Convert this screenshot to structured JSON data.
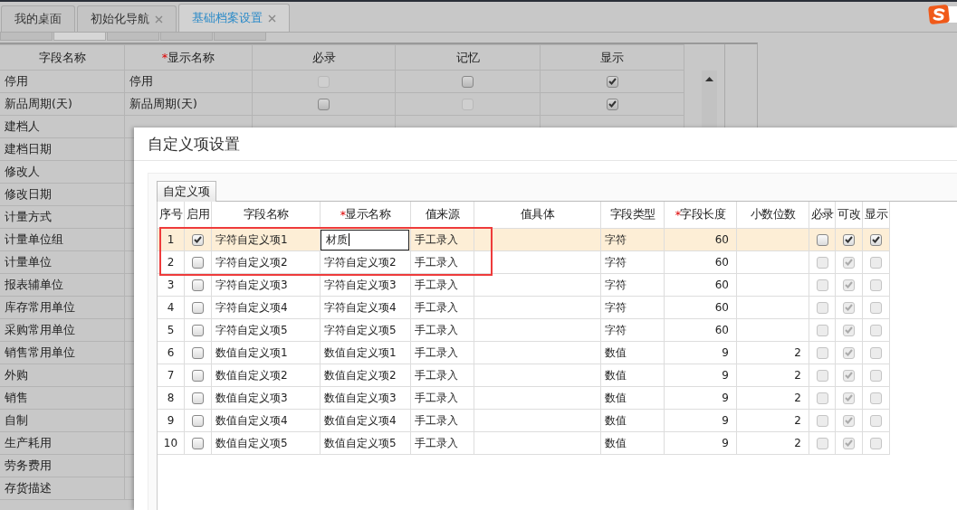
{
  "tabs": [
    {
      "label": "我的桌面",
      "closable": false,
      "selected": false
    },
    {
      "label": "初始化导航",
      "closable": true,
      "selected": false
    },
    {
      "label": "基础档案设置",
      "closable": true,
      "selected": true
    }
  ],
  "sub_tabs": [
    {
      "selected": false
    },
    {
      "selected": true
    },
    {
      "selected": false
    },
    {
      "selected": false
    },
    {
      "selected": false
    }
  ],
  "field_table": {
    "columns": [
      {
        "label": "字段名称"
      },
      {
        "mark": "*",
        "label": "显示名称"
      },
      {
        "label": "必录"
      },
      {
        "label": "记忆"
      },
      {
        "label": "显示"
      }
    ],
    "rows": [
      {
        "field": "停用",
        "display": "停用",
        "required": {
          "checked": false,
          "disabled": true
        },
        "remember": {
          "checked": false,
          "disabled": false
        },
        "show": {
          "checked": true,
          "disabled": false
        }
      },
      {
        "field": "新品周期(天)",
        "display": "新品周期(天)",
        "required": {
          "checked": false,
          "disabled": false
        },
        "remember": {
          "checked": false,
          "disabled": true
        },
        "show": {
          "checked": true,
          "disabled": false
        }
      },
      {
        "field": "建档人"
      },
      {
        "field": "建档日期"
      },
      {
        "field": "修改人"
      },
      {
        "field": "修改日期"
      },
      {
        "field": "计量方式"
      },
      {
        "field": "计量单位组"
      },
      {
        "field": "计量单位"
      },
      {
        "field": "报表辅单位"
      },
      {
        "field": "库存常用单位"
      },
      {
        "field": "采购常用单位"
      },
      {
        "field": "销售常用单位"
      },
      {
        "field": "外购"
      },
      {
        "field": "销售"
      },
      {
        "field": "自制"
      },
      {
        "field": "生产耗用"
      },
      {
        "field": "劳务费用"
      },
      {
        "field": "存货描述"
      }
    ]
  },
  "dialog": {
    "title": "自定义项设置",
    "tab": {
      "label": "自定义项"
    },
    "columns": [
      {
        "label": "序号"
      },
      {
        "label": "启用"
      },
      {
        "label": "字段名称"
      },
      {
        "mark": "*",
        "label": "显示名称"
      },
      {
        "label": "值来源"
      },
      {
        "label": "值具体"
      },
      {
        "label": "字段类型"
      },
      {
        "mark": "*",
        "label": "字段长度"
      },
      {
        "label": "小数位数"
      },
      {
        "label": "必录"
      },
      {
        "label": "可改"
      },
      {
        "label": "显示"
      }
    ],
    "rows": [
      {
        "no": "1",
        "selected": true,
        "enabled": {
          "checked": true,
          "disabled": false
        },
        "field": "字符自定义项1",
        "display": "材质",
        "editing": true,
        "source": "手工录入",
        "type": "字符",
        "length": "60",
        "required": {
          "checked": false,
          "disabled": false
        },
        "editable": {
          "checked": true,
          "disabled": false
        },
        "show": {
          "checked": true,
          "disabled": false
        }
      },
      {
        "no": "2",
        "selected": false,
        "enabled": {
          "checked": false,
          "disabled": false
        },
        "field": "字符自定义项2",
        "display": "字符自定义项2",
        "editing": false,
        "source": "手工录入",
        "type": "字符",
        "length": "60",
        "required": {
          "checked": false,
          "disabled": true
        },
        "editable": {
          "checked": true,
          "disabled": true
        },
        "show": {
          "checked": false,
          "disabled": true
        }
      },
      {
        "no": "3",
        "selected": false,
        "enabled": {
          "checked": false,
          "disabled": false
        },
        "field": "字符自定义项3",
        "display": "字符自定义项3",
        "editing": false,
        "source": "手工录入",
        "type": "字符",
        "length": "60",
        "required": {
          "checked": false,
          "disabled": true
        },
        "editable": {
          "checked": true,
          "disabled": true
        },
        "show": {
          "checked": false,
          "disabled": true
        }
      },
      {
        "no": "4",
        "selected": false,
        "enabled": {
          "checked": false,
          "disabled": false
        },
        "field": "字符自定义项4",
        "display": "字符自定义项4",
        "editing": false,
        "source": "手工录入",
        "type": "字符",
        "length": "60",
        "required": {
          "checked": false,
          "disabled": true
        },
        "editable": {
          "checked": true,
          "disabled": true
        },
        "show": {
          "checked": false,
          "disabled": true
        }
      },
      {
        "no": "5",
        "selected": false,
        "enabled": {
          "checked": false,
          "disabled": false
        },
        "field": "字符自定义项5",
        "display": "字符自定义项5",
        "editing": false,
        "source": "手工录入",
        "type": "字符",
        "length": "60",
        "required": {
          "checked": false,
          "disabled": true
        },
        "editable": {
          "checked": true,
          "disabled": true
        },
        "show": {
          "checked": false,
          "disabled": true
        }
      },
      {
        "no": "6",
        "selected": false,
        "enabled": {
          "checked": false,
          "disabled": false
        },
        "field": "数值自定义项1",
        "display": "数值自定义项1",
        "editing": false,
        "source": "手工录入",
        "type": "数值",
        "length": "9",
        "decimals": "2",
        "required": {
          "checked": false,
          "disabled": true
        },
        "editable": {
          "checked": true,
          "disabled": true
        },
        "show": {
          "checked": false,
          "disabled": true
        }
      },
      {
        "no": "7",
        "selected": false,
        "enabled": {
          "checked": false,
          "disabled": false
        },
        "field": "数值自定义项2",
        "display": "数值自定义项2",
        "editing": false,
        "source": "手工录入",
        "type": "数值",
        "length": "9",
        "decimals": "2",
        "required": {
          "checked": false,
          "disabled": true
        },
        "editable": {
          "checked": true,
          "disabled": true
        },
        "show": {
          "checked": false,
          "disabled": true
        }
      },
      {
        "no": "8",
        "selected": false,
        "enabled": {
          "checked": false,
          "disabled": false
        },
        "field": "数值自定义项3",
        "display": "数值自定义项3",
        "editing": false,
        "source": "手工录入",
        "type": "数值",
        "length": "9",
        "decimals": "2",
        "required": {
          "checked": false,
          "disabled": true
        },
        "editable": {
          "checked": true,
          "disabled": true
        },
        "show": {
          "checked": false,
          "disabled": true
        }
      },
      {
        "no": "9",
        "selected": false,
        "enabled": {
          "checked": false,
          "disabled": false
        },
        "field": "数值自定义项4",
        "display": "数值自定义项4",
        "editing": false,
        "source": "手工录入",
        "type": "数值",
        "length": "9",
        "decimals": "2",
        "required": {
          "checked": false,
          "disabled": true
        },
        "editable": {
          "checked": true,
          "disabled": true
        },
        "show": {
          "checked": false,
          "disabled": true
        }
      },
      {
        "no": "10",
        "selected": false,
        "enabled": {
          "checked": false,
          "disabled": false
        },
        "field": "数值自定义项5",
        "display": "数值自定义项5",
        "editing": false,
        "source": "手工录入",
        "type": "数值",
        "length": "9",
        "decimals": "2",
        "required": {
          "checked": false,
          "disabled": true
        },
        "editable": {
          "checked": true,
          "disabled": true
        },
        "show": {
          "checked": false,
          "disabled": true
        }
      }
    ]
  }
}
